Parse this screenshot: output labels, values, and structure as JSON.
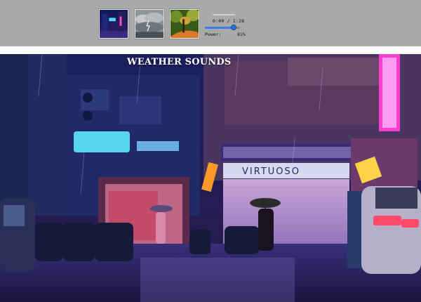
{
  "app": {
    "title": "WEATHER SOUNDS"
  },
  "thumbnails": [
    {
      "icon": "rain-city-thumbnail"
    },
    {
      "icon": "storm-clouds-thumbnail"
    },
    {
      "icon": "forest-thumbnail"
    }
  ],
  "player": {
    "time_display": "0:00 / 1:28",
    "progress_fraction": 0.0,
    "power_label": "Power:",
    "power_value": "81%",
    "power_fraction": 0.81
  },
  "scene": {
    "neon_sign": "VIRTUOSO",
    "accent_color": "#4a7bd6"
  }
}
